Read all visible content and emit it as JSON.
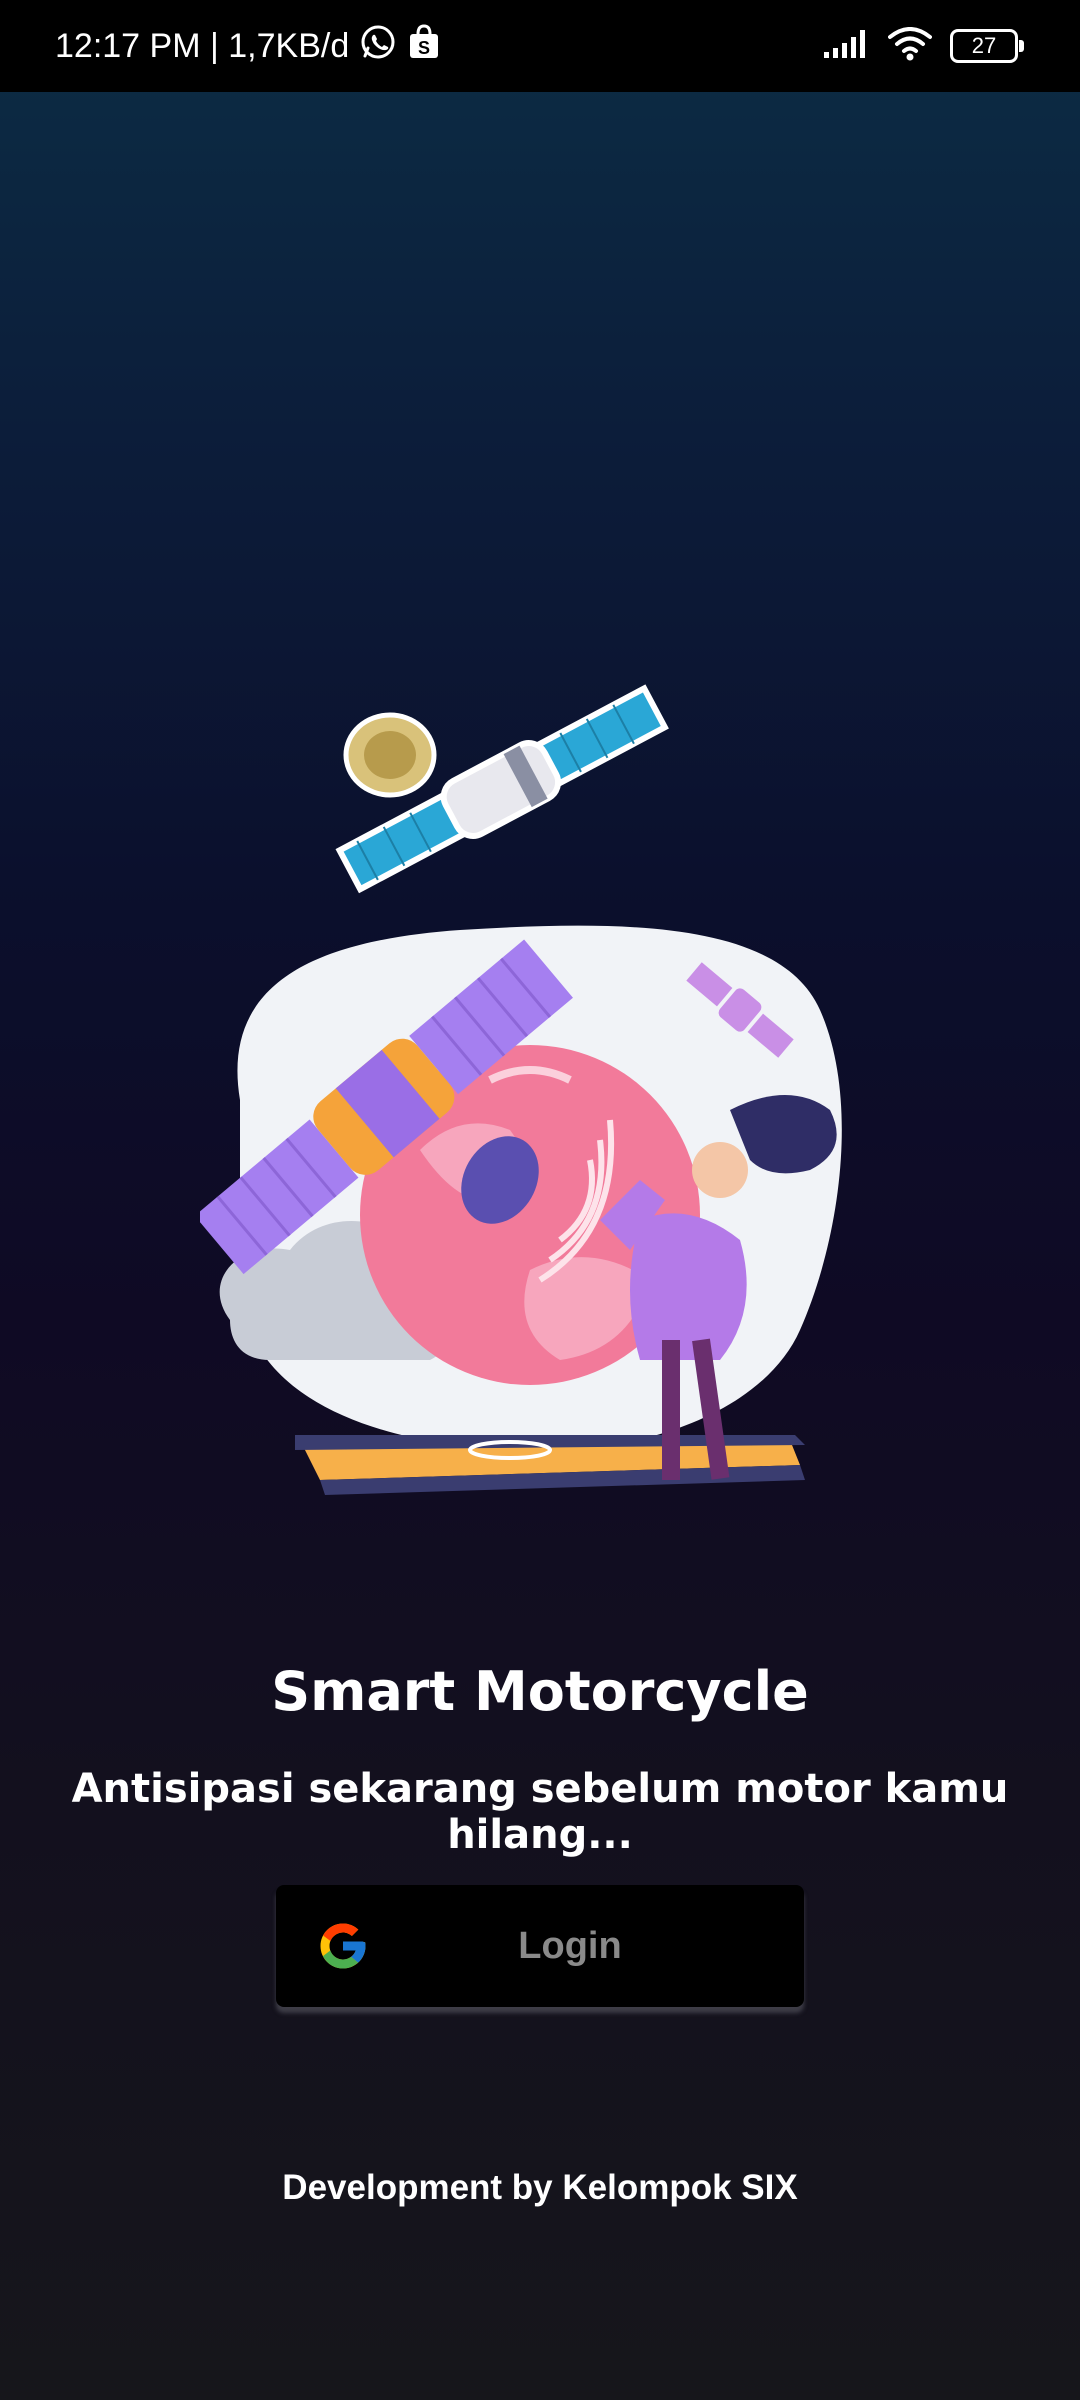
{
  "status_bar": {
    "time_and_speed": "12:17 PM | 1,7KB/d",
    "battery_level": "27",
    "icons": [
      "whatsapp-icon",
      "shopping-bag-icon",
      "signal-icon",
      "wifi-icon",
      "battery-icon"
    ]
  },
  "hero": {
    "illustration": "satellite-and-globe-illustration"
  },
  "app": {
    "title": "Smart Motorcycle",
    "tagline": "Antisipasi sekarang sebelum motor kamu hilang..."
  },
  "login": {
    "label": "Login",
    "icon": "google-icon"
  },
  "footer": {
    "credit": "Development by Kelompok SIX"
  },
  "colors": {
    "background_top": "#0c2d45",
    "background_bottom": "#16161b",
    "button_bg": "#000000",
    "button_text": "#8a8a8a",
    "text": "#ffffff"
  }
}
